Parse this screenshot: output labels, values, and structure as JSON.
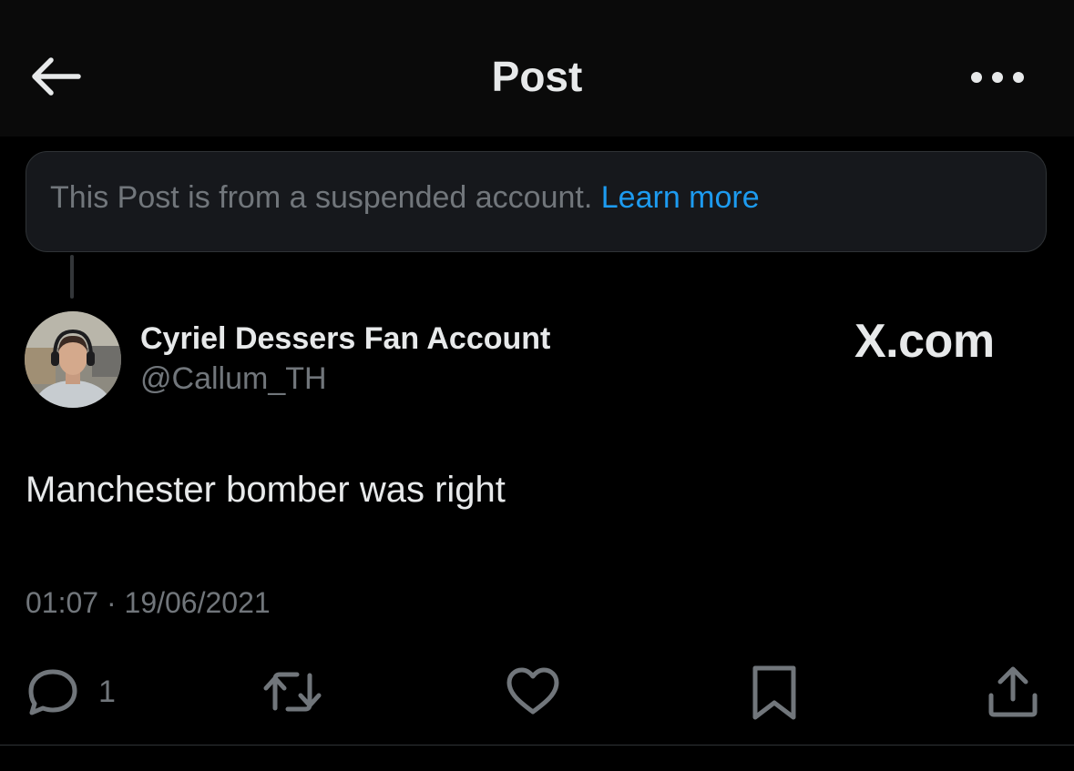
{
  "header": {
    "title": "Post",
    "back_icon": "arrow-left-icon",
    "more_icon": "more-horizontal-icon"
  },
  "notice": {
    "text": "This Post is from a suspended account.",
    "link_label": "Learn more",
    "link_color": "#1d9bf0"
  },
  "author": {
    "display_name": "Cyriel Dessers Fan Account",
    "handle": "@Callum_TH",
    "avatar_icon": "user-avatar"
  },
  "watermark": "X.com",
  "post": {
    "text": "Manchester bomber was right",
    "timestamp": "01:07 · 19/06/2021"
  },
  "actions": {
    "reply_count": "1",
    "icons": [
      "reply-icon",
      "repost-icon",
      "like-icon",
      "bookmark-icon",
      "share-icon"
    ]
  },
  "colors": {
    "background": "#000000",
    "text_primary": "#e7e9ea",
    "text_secondary": "#71767b",
    "accent": "#1d9bf0"
  }
}
